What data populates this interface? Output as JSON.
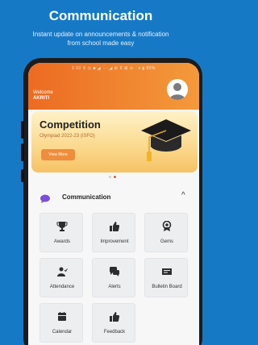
{
  "promo": {
    "title": "Communication",
    "subtitle_line1": "Instant update on announcements & notification",
    "subtitle_line2": "from school made easy"
  },
  "status_bar": {
    "text": "1:10 ⚲ ◷ ■ ◢ ··· ◢ ⊞ ⊼ ⊠ ⊙ ·   ▾ ▮ 80%"
  },
  "header": {
    "welcome": "Welcome",
    "username": "AKRITI",
    "avatar_icon": "user-avatar-icon"
  },
  "banner": {
    "title": "Competition",
    "subtitle": "Olympiad 2022-23 (ISFO)",
    "button_label": "View More",
    "illustration": "graduation-cap-icon"
  },
  "carousel": {
    "active_index": 1,
    "count": 2
  },
  "section": {
    "title": "Communication",
    "toggle": "^",
    "icon": "chat-bubble-icon"
  },
  "tiles": [
    {
      "label": "Awards",
      "icon": "trophy-icon"
    },
    {
      "label": "Improvement",
      "icon": "thumbs-up-icon"
    },
    {
      "label": "Gems",
      "icon": "medal-icon"
    },
    {
      "label": "Attendance",
      "icon": "person-icon"
    },
    {
      "label": "Alerts",
      "icon": "chat-icon"
    },
    {
      "label": "Bulletin Board",
      "icon": "board-icon"
    },
    {
      "label": "Calendar",
      "icon": "calendar-icon"
    },
    {
      "label": "Feedback",
      "icon": "thumbs-up-icon"
    }
  ],
  "colors": {
    "background": "#1679c6",
    "header_orange": "#ec6b22",
    "tile_bg": "#eceef0",
    "dot_active": "#e05a2b"
  }
}
